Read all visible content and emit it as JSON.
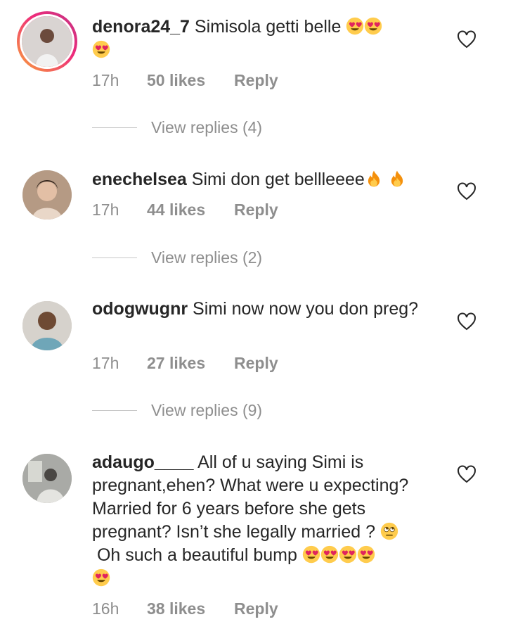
{
  "comments": [
    {
      "username": "denora24_7",
      "text": "Simisola getti belle",
      "time": "17h",
      "likes": "50 likes",
      "reply_label": "Reply",
      "view_replies": "View replies (4)",
      "emojis": [
        "heart-eyes",
        "heart-eyes",
        "heart-eyes"
      ]
    },
    {
      "username": "enechelsea",
      "text": "Simi don get bellleeee",
      "time": "17h",
      "likes": "44 likes",
      "reply_label": "Reply",
      "view_replies": "View replies (2)",
      "emojis": [
        "fire",
        "fire"
      ]
    },
    {
      "username": "odogwugnr",
      "text": "Simi now now you don preg?",
      "time": "17h",
      "likes": "27 likes",
      "reply_label": "Reply",
      "view_replies": "View replies (9)",
      "emojis": []
    },
    {
      "username": "adaugo____",
      "text": "All of u saying Simi is pregnant,ehen? What were u expecting? Married for 6 years before she gets pregnant? Isn’t she legally married ?",
      "text2": "Oh such a beautiful bump",
      "time": "16h",
      "likes": "38 likes",
      "reply_label": "Reply",
      "emojis": [
        "eye-roll",
        "heart-eyes",
        "heart-eyes",
        "heart-eyes",
        "heart-eyes",
        "heart-eyes"
      ]
    }
  ],
  "colors": {
    "text": "#262626",
    "muted": "#8e8e8e",
    "story_ring_start": "#f9a33a",
    "story_ring_end": "#c13584"
  },
  "icons": {
    "like": "heart-outline-icon",
    "emoji_love": "heart-eyes-emoji",
    "emoji_fire": "fire-emoji",
    "emoji_roll": "eye-roll-emoji"
  }
}
